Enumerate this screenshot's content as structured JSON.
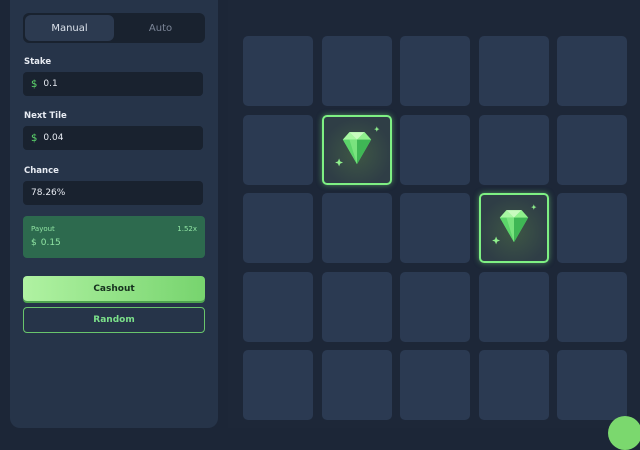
{
  "tabs": [
    {
      "label": "Manual",
      "active": true
    },
    {
      "label": "Auto",
      "active": false
    }
  ],
  "stake": {
    "label": "Stake",
    "currency": "$",
    "value": "0.1"
  },
  "next_tile": {
    "label": "Next Tile",
    "currency": "$",
    "value": "0.04"
  },
  "chance": {
    "label": "Chance",
    "value": "78.26%"
  },
  "payout": {
    "label": "Payout",
    "multiplier": "1.52x",
    "currency": "$",
    "value": "0.15"
  },
  "buttons": {
    "cashout": "Cashout",
    "random": "Random"
  },
  "board": {
    "rows": 5,
    "cols": 5,
    "revealed_gems": [
      [
        1,
        1
      ],
      [
        2,
        3
      ]
    ]
  },
  "colors": {
    "accent_green": "#7ef083",
    "panel": "#263449",
    "tile": "#2b3a52"
  }
}
